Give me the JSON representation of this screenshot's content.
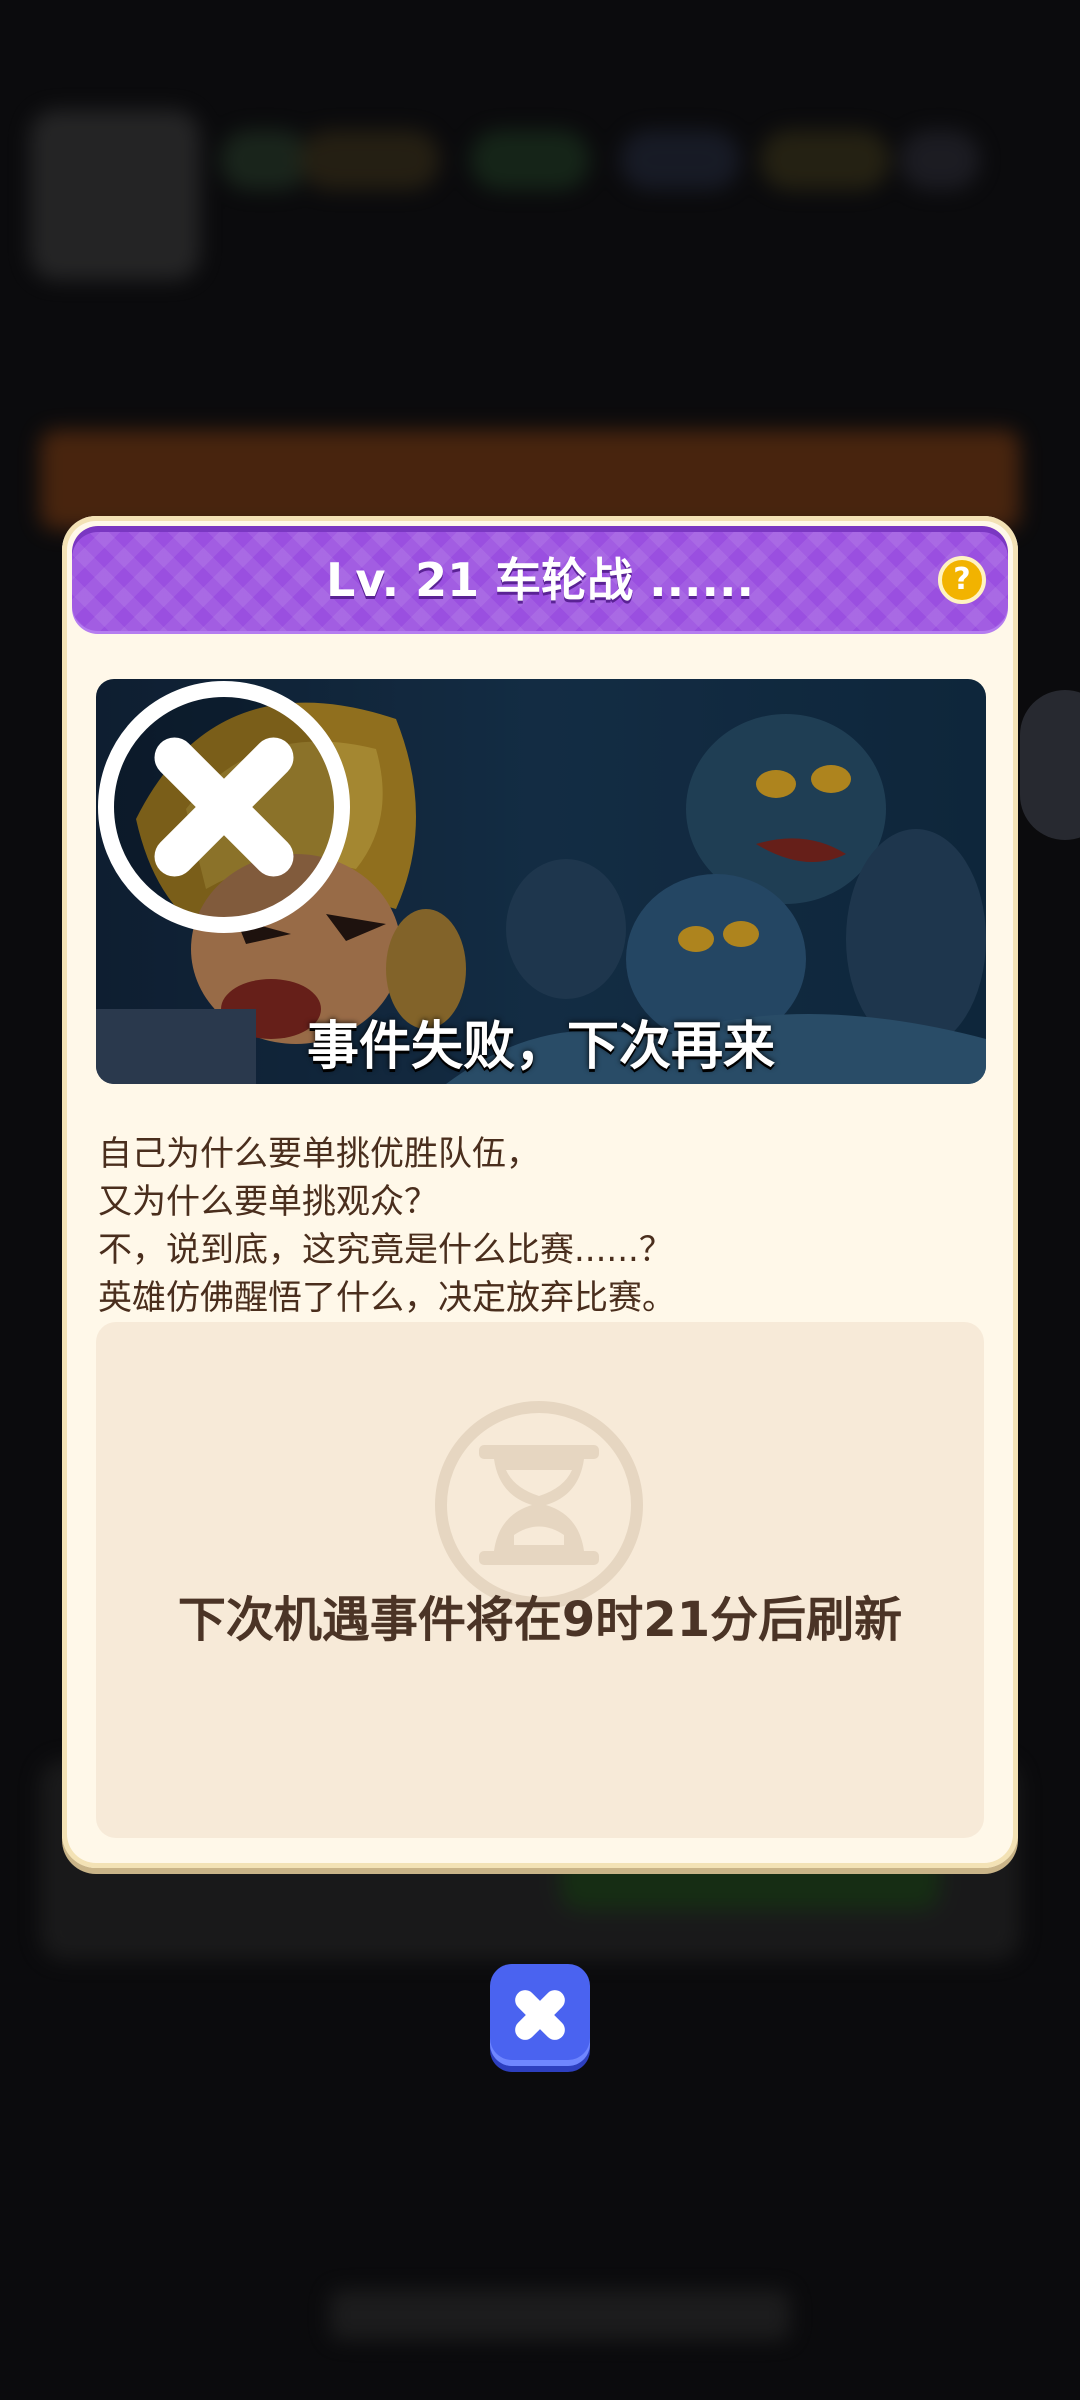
{
  "dialog": {
    "title": "Lv. 21 车轮战 ......",
    "help_icon": "question-icon",
    "banner_caption": "事件失败，下次再来",
    "story_lines": [
      "自己为什么要单挑优胜队伍，",
      "又为什么要单挑观众？",
      "不，说到底，这究竟是什么比赛......？",
      "英雄仿佛醒悟了什么，决定放弃比赛。"
    ],
    "refresh_text": "下次机遇事件将在9时21分后刷新"
  },
  "close_button": {
    "icon": "close-icon"
  },
  "colors": {
    "title_bar": "#9a4fe0",
    "dialog_bg": "#fff8e9",
    "close_button": "#4a63f0",
    "help_button": "#f2b300"
  }
}
